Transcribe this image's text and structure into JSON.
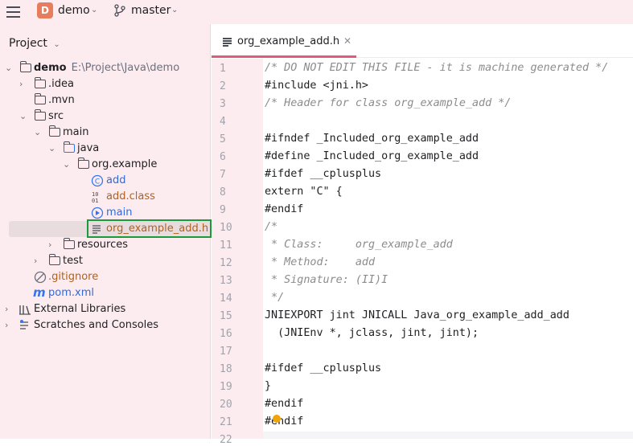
{
  "topbar": {
    "project_badge": "D",
    "project_name": "demo",
    "branch_name": "master"
  },
  "sidebar": {
    "title": "Project",
    "tree": [
      {
        "label": "demo",
        "path": "E:\\Project\\Java\\demo"
      },
      {
        "label": ".idea"
      },
      {
        "label": ".mvn"
      },
      {
        "label": "src"
      },
      {
        "label": "main"
      },
      {
        "label": "java"
      },
      {
        "label": "org.example"
      },
      {
        "label": "add"
      },
      {
        "label": "add.class"
      },
      {
        "label": "main"
      },
      {
        "label": "org_example_add.h"
      },
      {
        "label": "resources"
      },
      {
        "label": "test"
      },
      {
        "label": ".gitignore"
      },
      {
        "label": "pom.xml"
      },
      {
        "label": "External Libraries"
      },
      {
        "label": "Scratches and Consoles"
      }
    ]
  },
  "editor": {
    "tab_label": "org_example_add.h",
    "line_numbers": [
      "1",
      "2",
      "3",
      "4",
      "5",
      "6",
      "7",
      "8",
      "9",
      "10",
      "11",
      "12",
      "13",
      "14",
      "15",
      "16",
      "17",
      "18",
      "19",
      "20",
      "21",
      "22"
    ],
    "lines": [
      "/* DO NOT EDIT THIS FILE - it is machine generated */",
      "#include <jni.h>",
      "/* Header for class org_example_add */",
      "",
      "#ifndef _Included_org_example_add",
      "#define _Included_org_example_add",
      "#ifdef __cplusplus",
      "extern \"C\" {",
      "#endif",
      "/*",
      " * Class:     org_example_add",
      " * Method:    add",
      " * Signature: (II)I",
      " */",
      "JNIEXPORT jint JNICALL Java_org_example_add_add",
      "  (JNIEnv *, jclass, jint, jint);",
      "",
      "#ifdef __cplusplus",
      "}",
      "#endif",
      "#endif",
      ""
    ]
  },
  "colors": {
    "sidebar_bg": "#fcecef",
    "accent": "#e05a7a",
    "selection_border": "#1a9a3a",
    "badge": "#e67e5d"
  }
}
